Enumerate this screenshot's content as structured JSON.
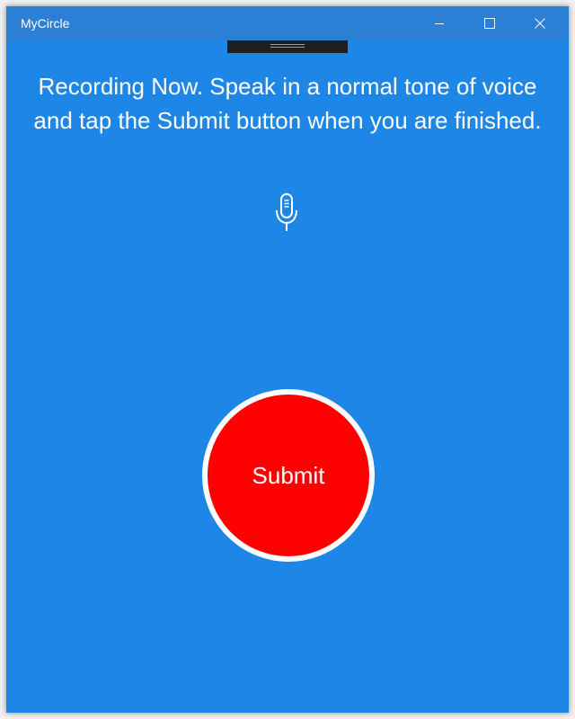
{
  "window": {
    "title": "MyCircle",
    "controls": [
      {
        "name": "minimize",
        "icon": "minimize-icon"
      },
      {
        "name": "maximize",
        "icon": "maximize-icon"
      },
      {
        "name": "close",
        "icon": "close-icon"
      }
    ]
  },
  "recording": {
    "instructions": "Recording Now. Speak in a normal tone of voice and tap the Submit button when you are finished.",
    "icon": "microphone-icon"
  },
  "submit": {
    "label": "Submit"
  },
  "colors": {
    "background": "#1e86e6",
    "titlebar": "#2b7fd4",
    "submit_fill": "#ff0000",
    "submit_border": "#ffffff",
    "text": "#ffffff"
  }
}
